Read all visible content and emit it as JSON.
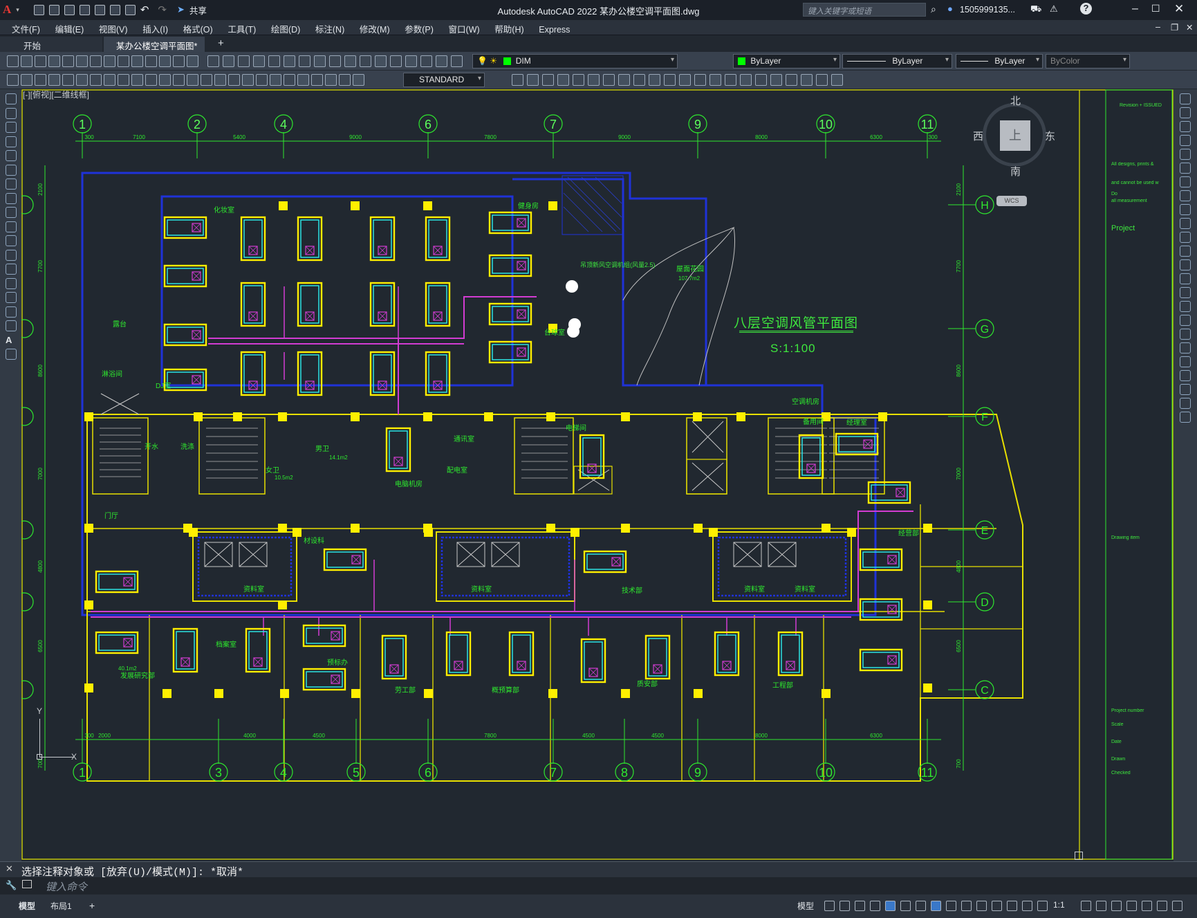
{
  "window": {
    "title": "Autodesk AutoCAD 2022    某办公楼空调平面图.dwg",
    "share_label": "共享",
    "search_placeholder": "键入关键字或短语",
    "user": "1505999135...",
    "app_letter": "A"
  },
  "menu": [
    "文件(F)",
    "编辑(E)",
    "视图(V)",
    "插入(I)",
    "格式(O)",
    "工具(T)",
    "绘图(D)",
    "标注(N)",
    "修改(M)",
    "参数(P)",
    "窗口(W)",
    "帮助(H)",
    "Express"
  ],
  "tabs": {
    "start": "开始",
    "drawing": "某办公楼空调平面图*",
    "close": "×",
    "add": "+"
  },
  "ribbon": {
    "layer": "DIM",
    "color": "ByLayer",
    "linetype": "ByLayer",
    "lineweight": "ByLayer",
    "plotstyle": "ByColor",
    "textstyle": "STANDARD"
  },
  "viewcube": {
    "north": "北",
    "south": "南",
    "east": "东",
    "west": "西",
    "top": "上",
    "wcs": "WCS"
  },
  "viewport_label": "[-][俯视][二维线框]",
  "drawing": {
    "title": "八层空调风管平面图",
    "scale": "S:1:100",
    "grid_top": [
      "1",
      "2",
      "4",
      "6",
      "7",
      "9",
      "10",
      "11"
    ],
    "grid_bottom": [
      "1",
      "3",
      "4",
      "5",
      "6",
      "7",
      "8",
      "9",
      "10",
      "11"
    ],
    "grid_rows": [
      "H",
      "G",
      "F",
      "E",
      "D",
      "C"
    ],
    "dims_top": [
      "300",
      "7100",
      "5400",
      "9000",
      "7800",
      "9000",
      "8000",
      "6300",
      "300"
    ],
    "dims_bottom": [
      "300",
      "2000",
      "4000",
      "4500",
      "7800",
      "4500",
      "4500",
      "8000",
      "6300"
    ],
    "dims_left": [
      "2100",
      "7700",
      "8600",
      "7000",
      "4800",
      "6500",
      "700"
    ],
    "rooms": [
      {
        "label": "化妆室"
      },
      {
        "label": "健身房"
      },
      {
        "label": "露台"
      },
      {
        "label": "台球室"
      },
      {
        "label": "屋面花园"
      },
      {
        "label": "107.7m2"
      },
      {
        "label": "淋浴间"
      },
      {
        "label": "DJ室"
      },
      {
        "label": "开水"
      },
      {
        "label": "洗涤"
      },
      {
        "label": "男卫"
      },
      {
        "label": "14.1m2"
      },
      {
        "label": "女卫"
      },
      {
        "label": "10.5m2"
      },
      {
        "label": "电脑机房"
      },
      {
        "label": "通讯室"
      },
      {
        "label": "配电室"
      },
      {
        "label": "电梯间"
      },
      {
        "label": "空调机房"
      },
      {
        "label": "备用间"
      },
      {
        "label": "经理室"
      },
      {
        "label": "经营部"
      },
      {
        "label": "门厅"
      },
      {
        "label": "材设科"
      },
      {
        "label": "资料室"
      },
      {
        "label": "资料室"
      },
      {
        "label": "技术部"
      },
      {
        "label": "资料室"
      },
      {
        "label": "资料室"
      },
      {
        "label": "档案室"
      },
      {
        "label": "预标办"
      },
      {
        "label": "劳工部"
      },
      {
        "label": "概预算部"
      },
      {
        "label": "质安部"
      },
      {
        "label": "工程部"
      },
      {
        "label": "发展研究部"
      },
      {
        "label": "40.1m2"
      }
    ],
    "equipment_note": "吊顶新风空调机组(风量2.5)",
    "side_panel": [
      "Revision + ISSUED",
      "All designs, prints &",
      "and cannot be used w",
      "Do",
      "all measurement",
      "Project",
      "Drawing item",
      "Project number",
      "Scale",
      "Date",
      "Drawn",
      "Checked"
    ]
  },
  "command": {
    "history": "选择注释对象或 [放弃(U)/模式(M)]: *取消*",
    "placeholder": "键入命令"
  },
  "status": {
    "model_tab": "模型",
    "layout_tab": "布局1",
    "model_btn": "模型",
    "scale": "1:1"
  },
  "colors": {
    "background": "#212830",
    "wall_blue": "#1f32d8",
    "column_yellow": "#ffef00",
    "grid_green": "#2ee82e",
    "duct_magenta": "#d23cd2",
    "fcu_cyan": "#2bf0f0",
    "wall_yellow": "#e8e000"
  }
}
